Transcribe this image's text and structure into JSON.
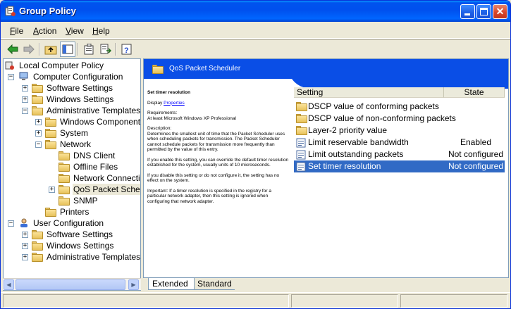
{
  "window": {
    "title": "Group Policy",
    "colors": {
      "titlebar": "#0053ee",
      "selection": "#316ac5",
      "header": "#0a4ee6"
    }
  },
  "menu": {
    "file": {
      "accel": "F",
      "rest": "ile"
    },
    "action": {
      "accel": "A",
      "rest": "ction"
    },
    "view": {
      "accel": "V",
      "rest": "iew"
    },
    "help": {
      "accel": "H",
      "rest": "elp"
    }
  },
  "toolbar": {
    "icons": [
      "back-arrow-icon",
      "forward-arrow-icon",
      "up-folder-icon",
      "show-hide-tree-icon",
      "properties-icon",
      "export-list-icon",
      "help-icon"
    ]
  },
  "tree": {
    "root": "Local Computer Policy",
    "computer_config": "Computer Configuration",
    "cc_software": "Software Settings",
    "cc_windows": "Windows Settings",
    "cc_admin": "Administrative Templates",
    "windows_components": "Windows Components",
    "system": "System",
    "network": "Network",
    "dns_client": "DNS Client",
    "offline_files": "Offline Files",
    "network_connections": "Network Connectio",
    "qos": "QoS Packet Schedu",
    "snmp": "SNMP",
    "printers": "Printers",
    "user_config": "User Configuration",
    "uc_software": "Software Settings",
    "uc_windows": "Windows Settings",
    "uc_admin": "Administrative Templates",
    "expander_plus": "+",
    "expander_minus": "−"
  },
  "details": {
    "header_title": "QoS Packet Scheduler",
    "setting_title": "Set timer resolution",
    "display_label": "Display",
    "properties_link": "Properties",
    "requirements_label": "Requirements:",
    "requirements_text": "At least Microsoft Windows XP Professional",
    "description_label": "Description:",
    "description_text": "Determines the smallest unit of time that the Packet Scheduler uses when scheduling packets for transmission. The Packet Scheduler cannot schedule packets for transmission more frequently than permitted by the value of this entry.",
    "enabled_text": "If you enable this setting, you can override the default timer resolution established for the system, usually units of 10 microseconds.",
    "disabled_text": "If you disable this setting or do not configure it, the setting has no effect on the system.",
    "important_text": "Important: If a timer resolution is specified in the registry for a particular network adapter, then this setting is ignored when configuring that network adapter."
  },
  "list": {
    "col_setting": "Setting",
    "col_state": "State",
    "rows": [
      {
        "label": "DSCP value of conforming packets",
        "state": "",
        "icon": "folder-icon"
      },
      {
        "label": "DSCP value of non-conforming packets",
        "state": "",
        "icon": "folder-icon"
      },
      {
        "label": "Layer-2 priority value",
        "state": "",
        "icon": "folder-icon"
      },
      {
        "label": "Limit reservable bandwidth",
        "state": "Enabled",
        "icon": "policy-setting-icon"
      },
      {
        "label": "Limit outstanding packets",
        "state": "Not configured",
        "icon": "policy-setting-icon"
      },
      {
        "label": "Set timer resolution",
        "state": "Not configured",
        "icon": "policy-setting-icon"
      }
    ]
  },
  "tabs": {
    "extended": "Extended",
    "standard": "Standard"
  }
}
